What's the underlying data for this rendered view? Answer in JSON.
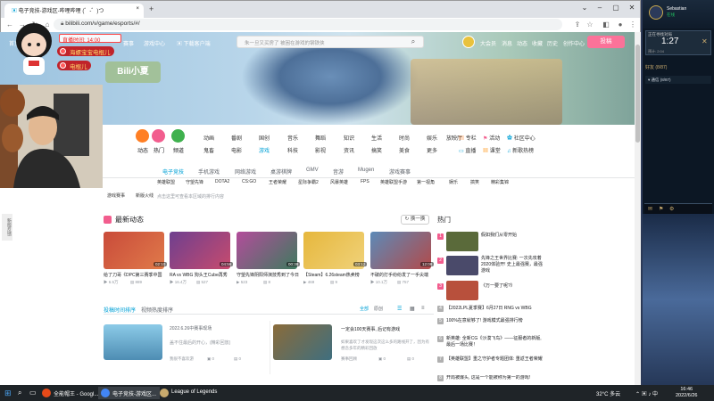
{
  "browser": {
    "tabs": [
      {
        "title": "电子竞技-游戏区-哔哩哔哩 (゜-゜)つ"
      },
      {
        "title": "+"
      }
    ],
    "url": "bilibili.com/v/game/esports/#/"
  },
  "site": {
    "nav_left": [
      "首页",
      "番剧",
      "直播",
      "游戏中心",
      "会员购",
      "漫画",
      "赛事"
    ],
    "nav_right": [
      "大会员",
      "消息",
      "动态",
      "收藏",
      "历史",
      "创作中心"
    ],
    "search_placeholder": "朱一旦又买房了 被困在游戏的钢铁侠",
    "upload_label": "投稿"
  },
  "overlay": {
    "live_time_label": "直播时间: 14:00",
    "pill1": "海螺宝宝电棍儿",
    "pill2": "电棍儿",
    "logo": "Bili小夏",
    "feedback": "新版反馈"
  },
  "categories": {
    "big": [
      {
        "label": "动态",
        "color": "#ff7f24"
      },
      {
        "label": "热门",
        "color": "#f25d8e"
      },
      {
        "label": "频道",
        "color": "#3fb14e"
      }
    ],
    "row1": [
      "动画",
      "番剧",
      "国创",
      "音乐",
      "舞蹈",
      "知识",
      "生活",
      "时尚",
      "娱乐",
      "放映厅"
    ],
    "row2": [
      "鬼畜",
      "电影",
      "游戏",
      "科技",
      "影视",
      "资讯",
      "搞笑",
      "美食",
      "运动",
      "更多"
    ],
    "right1": [
      "专栏",
      "活动",
      "社区中心"
    ],
    "right2": [
      "直播",
      "课堂",
      "新歌热榜"
    ]
  },
  "section_tabs": [
    "电子竞技",
    "手机游戏",
    "网络游戏",
    "桌游棋牌",
    "GMV",
    "音游",
    "Mugen",
    "游戏赛事"
  ],
  "sub_note": "点击这里可查看本区域的排行内容",
  "tags": [
    "英雄联盟",
    "守望先锋",
    "DOTA2",
    "CS:GO",
    "王者荣耀",
    "星际争霸2",
    "风暴英雄",
    "FPS",
    "英雄联盟手游",
    "第一视角",
    "娱乐",
    "搞笑",
    "精彩集锦",
    "游戏赛事",
    "新版火线"
  ],
  "latest": {
    "title": "最新动态",
    "refresh": "换一换",
    "videos": [
      {
        "title": "给了刀哥《DPC第三赛季中国",
        "views": "6.5万",
        "danmaku": "889",
        "duration": "02:10",
        "thumb": "#c94b3a"
      },
      {
        "title": "RA vs WBG 狗头王Cube再秀",
        "views": "16.4万",
        "danmaku": "527",
        "duration": "04:56",
        "thumb": "#6e3f8f"
      },
      {
        "title": "守望先锋阴阳师演技秀到了今日",
        "views": "523",
        "danmaku": "8",
        "duration": "00:38",
        "thumb": "#b34c9b"
      },
      {
        "title": "【Steam】6.26steam热卖榜",
        "views": "469",
        "danmaku": "9",
        "duration": "03:12",
        "thumb": "#e6b73c"
      },
      {
        "title": "不破的打手纷纷发了一手尖端",
        "views": "10.1万",
        "danmaku": "757",
        "duration": "12:08",
        "thumb": "#5c8ab8"
      }
    ]
  },
  "hot": {
    "title": "热门",
    "items": [
      {
        "rank": "1",
        "title": "假如我们从零开始",
        "thumb": "#5a6a3a"
      },
      {
        "rank": "2",
        "title": "先锋之王世界比赛: 一次先攻着2020体验开! 史上最强赛，最强游戏",
        "thumb": "#4a4a6a"
      },
      {
        "rank": "3",
        "title": "《万一要了呢?》",
        "thumb": "#b8503c"
      },
      {
        "rank": "4",
        "title": "【2022LPL夏季赛】6月27日 RNG vs WBG",
        "thumb": ""
      },
      {
        "rank": "5",
        "title": "100%在意就够了! 游戏模式最强排行榜",
        "thumb": ""
      },
      {
        "rank": "6",
        "title": "新英雄: 全新CG《沙漠飞鸟》——征服者的新版, 最后一场比赛！",
        "thumb": ""
      },
      {
        "rank": "7",
        "title": "【英雄联盟】重之守护者专题团体: 重返王者荣耀",
        "thumb": ""
      },
      {
        "rank": "8",
        "title": "开局被爆头, 这是一个能被称为第一的游戏!",
        "thumb": ""
      }
    ]
  },
  "feed": {
    "tab_active": "投稿时间排序",
    "tab_other": "视频热度排序",
    "view_options": [
      "全部",
      "原创"
    ],
    "items": [
      {
        "date": "2022.6.26中赛事现场",
        "desc": "盖不住最后的开心，(精彩回放)",
        "author": "我很不喜欢游",
        "likes": "0",
        "comments": "0",
        "thumb": "#6fb0d6"
      },
      {
        "date": "",
        "desc": "一定会100天赛事, 后记有游戏",
        "desc2": "如果喜欢了才发现这次这么多的路线开了，因为有想念多年的精彩回放",
        "author": "赛事回顾",
        "likes": "0",
        "comments": "0",
        "thumb": "#8a6b3a"
      }
    ]
  },
  "lol": {
    "name": "Sebastian",
    "status": "在线",
    "queue_title": "正在寻找对局",
    "timer": "1:27",
    "queue_sub": "预计: 2:04",
    "friends_header": "好友 (8/87)",
    "friend_row": "通信 (8/87)"
  },
  "taskbar": {
    "apps": [
      {
        "label": "全能帽王 - Googl...",
        "color": "#e64a19"
      },
      {
        "label": "电子竞技-游戏区...",
        "color": "#4285f4"
      },
      {
        "label": "League of Legends",
        "color": "#c8aa6e"
      }
    ],
    "weather": "32°C 多云",
    "time": "16:46",
    "date": "2022/6/26"
  }
}
